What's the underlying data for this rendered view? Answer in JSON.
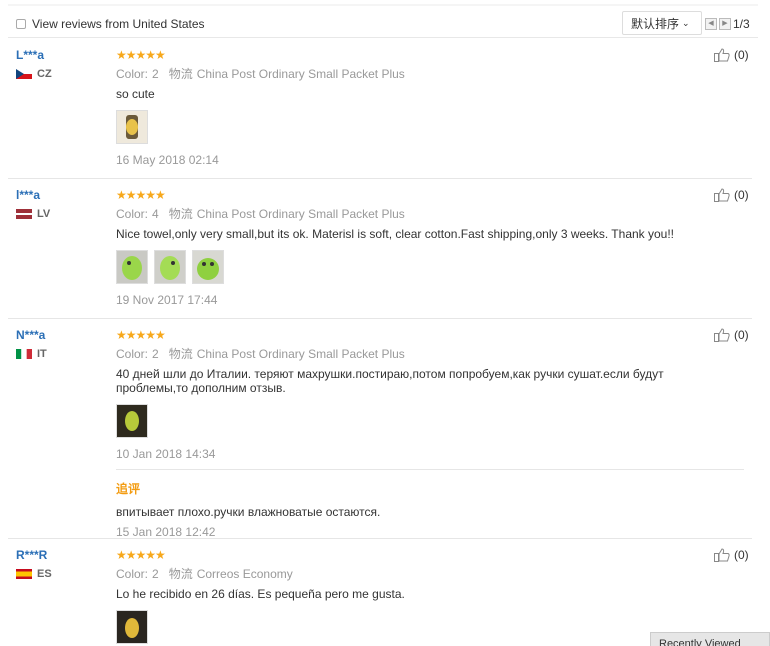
{
  "toolbar": {
    "filter_label": "View reviews from United States",
    "sort_label": "默认排序",
    "page_indicator": "1/3"
  },
  "reviews": [
    {
      "user": "L***a",
      "country": "CZ",
      "stars": "★★★★★",
      "color_key": "Color:",
      "color_val": "2",
      "ship_key": "物流",
      "ship_val": "China Post Ordinary Small Packet Plus",
      "text": "so cute",
      "date": "16 May 2018 02:14",
      "helpful": "(0)"
    },
    {
      "user": "l***a",
      "country": "LV",
      "stars": "★★★★★",
      "color_key": "Color:",
      "color_val": "4",
      "ship_key": "物流",
      "ship_val": "China Post Ordinary Small Packet Plus",
      "text": "Nice towel,only very small,but its ok. Materisl is soft, clear cotton.Fast shipping,only 3 weeks. Thank you!!",
      "date": "19 Nov 2017 17:44",
      "helpful": "(0)"
    },
    {
      "user": "N***a",
      "country": "IT",
      "stars": "★★★★★",
      "color_key": "Color:",
      "color_val": "2",
      "ship_key": "物流",
      "ship_val": "China Post Ordinary Small Packet Plus",
      "text": "40 дней шли до Италии. теряют махрушки.постираю,потом попробуем,как ручки сушат.если будут проблемы,то дополним отзыв.",
      "date": "10 Jan 2018 14:34",
      "followup_label": "追评",
      "followup_text": "впитывает плохо.ручки влажноватые остаются.",
      "followup_date": "15 Jan 2018 12:42",
      "helpful": "(0)"
    },
    {
      "user": "R***R",
      "country": "ES",
      "stars": "★★★★★",
      "color_key": "Color:",
      "color_val": "2",
      "ship_key": "物流",
      "ship_val": "Correos Economy",
      "text": "Lo he recibido en 26 días. Es pequeña pero me gusta.",
      "helpful": "(0)"
    }
  ],
  "recent_panel": "Recently Viewed"
}
